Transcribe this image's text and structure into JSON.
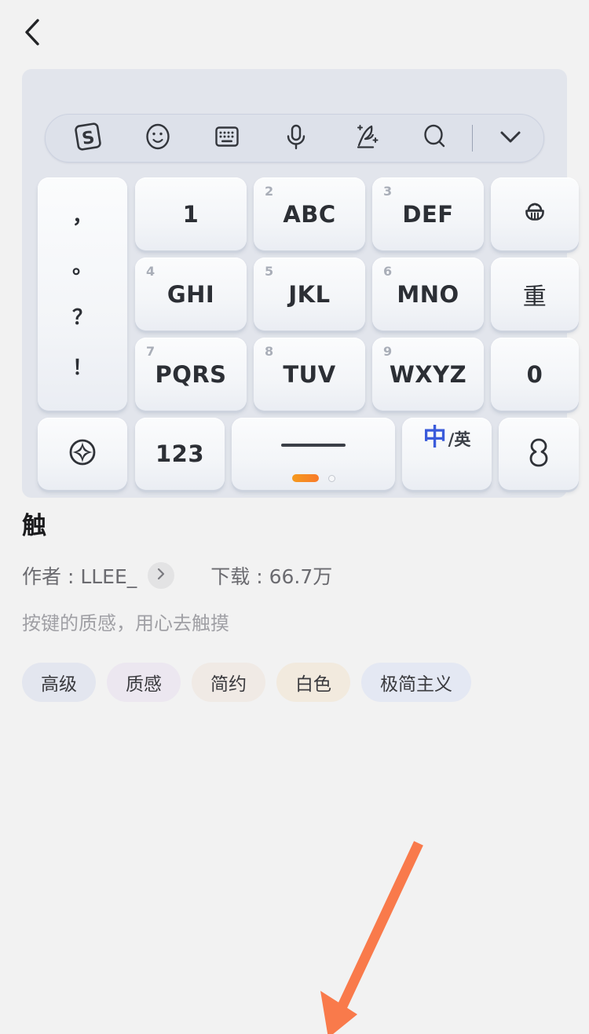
{
  "header": {
    "back_icon": "chevron-left-icon"
  },
  "keyboard_preview": {
    "toolbar": {
      "icons": [
        {
          "name": "sogou-logo-icon",
          "label": "S"
        },
        {
          "name": "emoji-face-icon",
          "label": ""
        },
        {
          "name": "keyboard-switch-icon",
          "label": ""
        },
        {
          "name": "microphone-icon",
          "label": ""
        },
        {
          "name": "handwriting-pen-icon",
          "label": ""
        },
        {
          "name": "search-icon",
          "label": ""
        }
      ],
      "collapse_icon": "chevron-down-icon"
    },
    "punct_key": {
      "name": "punctuation-key",
      "marks": [
        "，",
        "。",
        "？",
        "！"
      ]
    },
    "keys": [
      {
        "name": "key-1",
        "sup": "",
        "label": "1"
      },
      {
        "name": "key-2-abc",
        "sup": "2",
        "label": "ABC"
      },
      {
        "name": "key-3-def",
        "sup": "3",
        "label": "DEF"
      },
      {
        "name": "key-delete",
        "sup": "",
        "label": "",
        "icon": "delete-backspace-icon"
      },
      {
        "name": "key-4-ghi",
        "sup": "4",
        "label": "GHI"
      },
      {
        "name": "key-5-jkl",
        "sup": "5",
        "label": "JKL"
      },
      {
        "name": "key-6-mno",
        "sup": "6",
        "label": "MNO"
      },
      {
        "name": "key-repeat",
        "sup": "",
        "label": "重"
      },
      {
        "name": "key-7-pqrs",
        "sup": "7",
        "label": "PQRS"
      },
      {
        "name": "key-8-tuv",
        "sup": "8",
        "label": "TUV"
      },
      {
        "name": "key-9-wxyz",
        "sup": "9",
        "label": "WXYZ"
      },
      {
        "name": "key-0",
        "sup": "",
        "label": "0"
      }
    ],
    "bottom_row": {
      "settings_key": {
        "name": "key-settings",
        "icon": "diamond-in-circle-icon"
      },
      "numeric_key": {
        "name": "key-numeric-symbols",
        "label": "123"
      },
      "space_key": {
        "name": "key-space",
        "label": "",
        "page_indicator": {
          "active": 1,
          "total": 2
        }
      },
      "lang_key": {
        "name": "key-language-toggle",
        "cn": "中",
        "en": "/英"
      },
      "enter_key": {
        "name": "key-enter",
        "icon": "enter-return-icon"
      }
    }
  },
  "theme": {
    "title": "触",
    "author_label": "作者 : LLEE_",
    "author_chevron_icon": "chevron-right-icon",
    "downloads_label": "下载 : 66.7万",
    "description": "按键的质感，用心去触摸",
    "tags": [
      {
        "label": "高级",
        "color": "#e3e6ef"
      },
      {
        "label": "质感",
        "color": "#ece7f0"
      },
      {
        "label": "简约",
        "color": "#f0eae5"
      },
      {
        "label": "白色",
        "color": "#f2eade"
      },
      {
        "label": "极简主义",
        "color": "#e4e8f3"
      }
    ]
  },
  "annotation": {
    "arrow": {
      "name": "pointer-arrow",
      "color": "#f97a4b"
    }
  },
  "colors": {
    "page_background": "#f2f2f2",
    "keyboard_panel": "#e2e5ec",
    "toolbar_background": "#dde1ea",
    "key_face": "#f5f7fa",
    "accent_blue": "#3a5bdb",
    "accent_orange": "#f97a4b"
  }
}
